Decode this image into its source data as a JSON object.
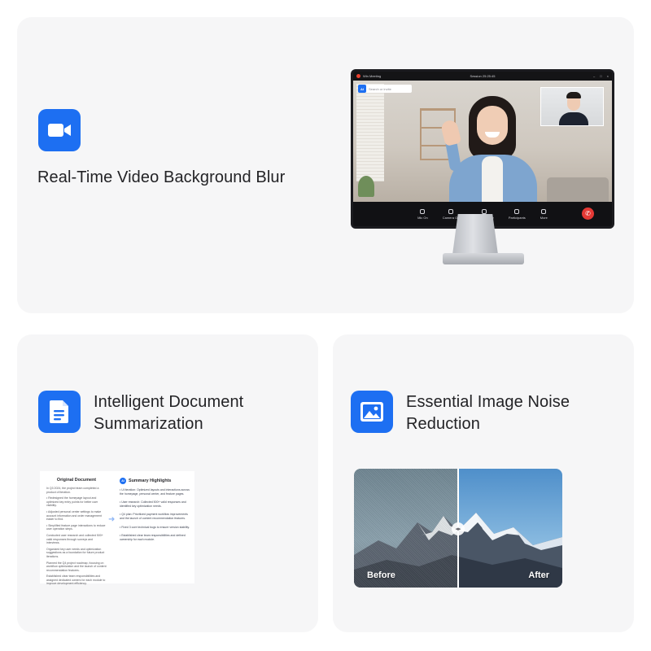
{
  "features": {
    "video_blur": {
      "title": "Real-Time Video Background Blur",
      "icon": "video-camera-icon"
    },
    "doc_summary": {
      "title_line1": "Intelligent Document",
      "title_line2": "Summarization",
      "icon": "document-icon"
    },
    "noise_reduction": {
      "title_line1": "Essential Image Noise",
      "title_line2": "Reduction",
      "icon": "image-icon"
    }
  },
  "meeting": {
    "app_name": "Win Meeting",
    "session": "Session 25:25:45",
    "ai_badge": "AI",
    "search_placeholder": "Search or invite",
    "toolbar": [
      "Mic On",
      "Camera On",
      "Screen Share",
      "Participants",
      "More"
    ]
  },
  "document": {
    "original_title": "Original Document",
    "original_paragraphs": [
      "In Q3 2024, the project team completed a product of iteration.",
      "• Redesigned the homepage layout and optimized key entry points for better user visibility.",
      "• Adjusted personal center settings to make account information and order management easier to find.",
      "• Simplified feature page interactions to reduce user operation steps.",
      "Conducted user research and collected 500+ valid responses through surveys and interviews.",
      "Organized key user needs and optimization suggestions as a foundation for future product iterations.",
      "Planned the Q4 project roadmap, focusing on workflow optimization and the launch of content recommendation features.",
      "Established clear team responsibilities and assigned dedicated owners for each module to improve development efficiency."
    ],
    "summary_title": "Summary Highlights",
    "summary_badge": "AI",
    "summary_items": [
      "• UI iteration: Optimized layouts and interactions across the homepage, personal center, and feature pages.",
      "• User research: Collected 500+ valid responses and identified key optimization needs.",
      "• Q4 plan: Prioritized payment workflow improvements and the launch of content recommendation features.",
      "• Fixed 3 core technical bugs to ensure version stability.",
      "• Established clear team responsibilities and defined ownership for each module."
    ]
  },
  "comparison": {
    "before_label": "Before",
    "after_label": "After"
  },
  "colors": {
    "accent": "#1d6ff2",
    "card_bg": "#f6f6f7",
    "title_text": "#232326"
  }
}
